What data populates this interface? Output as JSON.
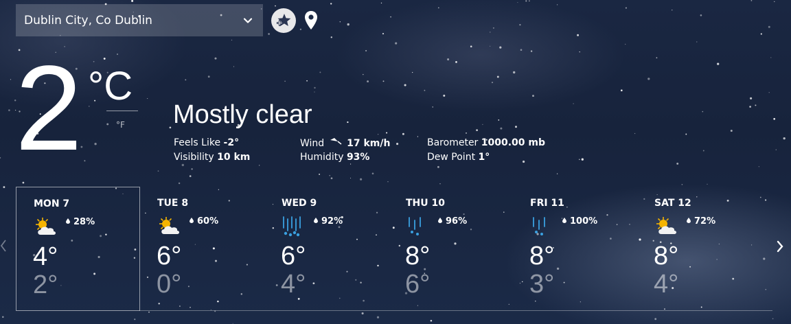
{
  "location": {
    "selected": "Dublin City, Co Dublin"
  },
  "current": {
    "temperature": "2",
    "unit_celsius": "°C",
    "unit_fahrenheit": "°F",
    "condition": "Mostly clear",
    "details": {
      "feels_like_label": "Feels Like",
      "feels_like_value": "-2°",
      "visibility_label": "Visibility",
      "visibility_value": "10 km",
      "wind_label": "Wind",
      "wind_value": "17 km/h",
      "humidity_label": "Humidity",
      "humidity_value": "93%",
      "barometer_label": "Barometer",
      "barometer_value": "1000.00 mb",
      "dew_point_label": "Dew Point",
      "dew_point_value": "1°"
    }
  },
  "forecast": [
    {
      "day": "MON 7",
      "icon": "partly-sunny-icon",
      "precip": "28%",
      "high": "4°",
      "low": "2°",
      "selected": true
    },
    {
      "day": "TUE 8",
      "icon": "partly-sunny-icon",
      "precip": "60%",
      "high": "6°",
      "low": "0°",
      "selected": false
    },
    {
      "day": "WED 9",
      "icon": "heavy-rain-icon",
      "precip": "92%",
      "high": "6°",
      "low": "4°",
      "selected": false
    },
    {
      "day": "THU 10",
      "icon": "rain-icon",
      "precip": "96%",
      "high": "8°",
      "low": "6°",
      "selected": false
    },
    {
      "day": "FRI 11",
      "icon": "rain-icon",
      "precip": "100%",
      "high": "8°",
      "low": "3°",
      "selected": false
    },
    {
      "day": "SAT 12",
      "icon": "partly-sunny-icon",
      "precip": "72%",
      "high": "8°",
      "low": "4°",
      "selected": false
    }
  ],
  "colors": {
    "accent_rain": "#3aa0e0",
    "sun": "#f5b400",
    "cloud": "#f2f2f2"
  }
}
